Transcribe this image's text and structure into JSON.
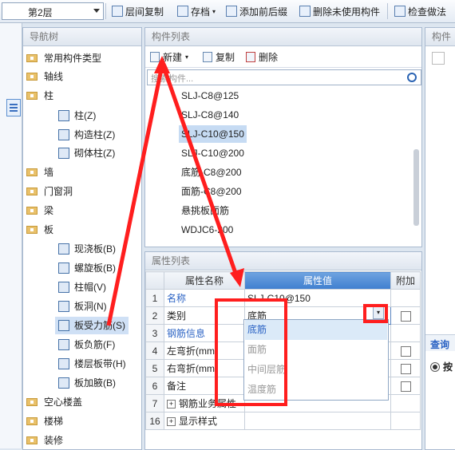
{
  "toolbar": {
    "floor": "第2层",
    "buttons": [
      "层间复制",
      "存档",
      "添加前后缀",
      "删除未使用构件",
      "检查做法"
    ]
  },
  "nav": {
    "title": "导航树",
    "items": [
      {
        "label": "常用构件类型"
      },
      {
        "label": "轴线"
      },
      {
        "label": "柱"
      },
      {
        "label": "柱(Z)"
      },
      {
        "label": "构造柱(Z)"
      },
      {
        "label": "砌体柱(Z)"
      },
      {
        "label": "墙"
      },
      {
        "label": "门窗洞"
      },
      {
        "label": "梁"
      },
      {
        "label": "板"
      },
      {
        "label": "现浇板(B)"
      },
      {
        "label": "螺旋板(B)"
      },
      {
        "label": "柱帽(V)"
      },
      {
        "label": "板洞(N)"
      },
      {
        "label": "板受力筋(S)"
      },
      {
        "label": "板负筋(F)"
      },
      {
        "label": "楼层板带(H)"
      },
      {
        "label": "板加腋(B)"
      },
      {
        "label": "空心楼盖"
      },
      {
        "label": "楼梯"
      },
      {
        "label": "装修"
      }
    ]
  },
  "component_list": {
    "title": "构件列表",
    "new_label": "新建",
    "copy_label": "复制",
    "delete_label": "删除",
    "search_placeholder": "搜索构件...",
    "items": [
      "SLJ-C8@125",
      "SLJ-C8@140",
      "SLJ-C10@150",
      "SLJ-C10@200",
      "底筋-C8@200",
      "面筋-C8@200",
      "悬挑板面筋",
      "WDJC6-200"
    ],
    "selected_index": 2
  },
  "properties": {
    "title": "属性列表",
    "headers": {
      "name": "属性名称",
      "value": "属性值",
      "extra": "附加"
    },
    "rows": [
      {
        "num": "1",
        "name": "名称",
        "value": "SLJ-C10@150",
        "blue": true,
        "check": false
      },
      {
        "num": "2",
        "name": "类别",
        "value": "底筋",
        "blue": false,
        "check": true
      },
      {
        "num": "3",
        "name": "钢筋信息",
        "value": "",
        "blue": true,
        "check": false
      },
      {
        "num": "4",
        "name": "左弯折(mm",
        "value": "",
        "blue": false,
        "check": true
      },
      {
        "num": "5",
        "name": "右弯折(mm",
        "value": "",
        "blue": false,
        "check": true
      },
      {
        "num": "6",
        "name": "备注",
        "value": "",
        "blue": false,
        "check": true
      },
      {
        "num": "7",
        "name": "钢筋业务属性",
        "value": "",
        "blue": false,
        "check": false,
        "expand": true
      },
      {
        "num": "16",
        "name": "显示样式",
        "value": "",
        "blue": false,
        "check": false,
        "expand": true
      }
    ],
    "dropdown_options": [
      "底筋",
      "面筋",
      "中间层筋",
      "温度筋"
    ]
  },
  "right_panel": {
    "title": "构件",
    "query_label": "查询",
    "radio_label": "按"
  },
  "colors": {
    "annotation": "#ff1e1e",
    "accent": "#3f7fcf"
  }
}
